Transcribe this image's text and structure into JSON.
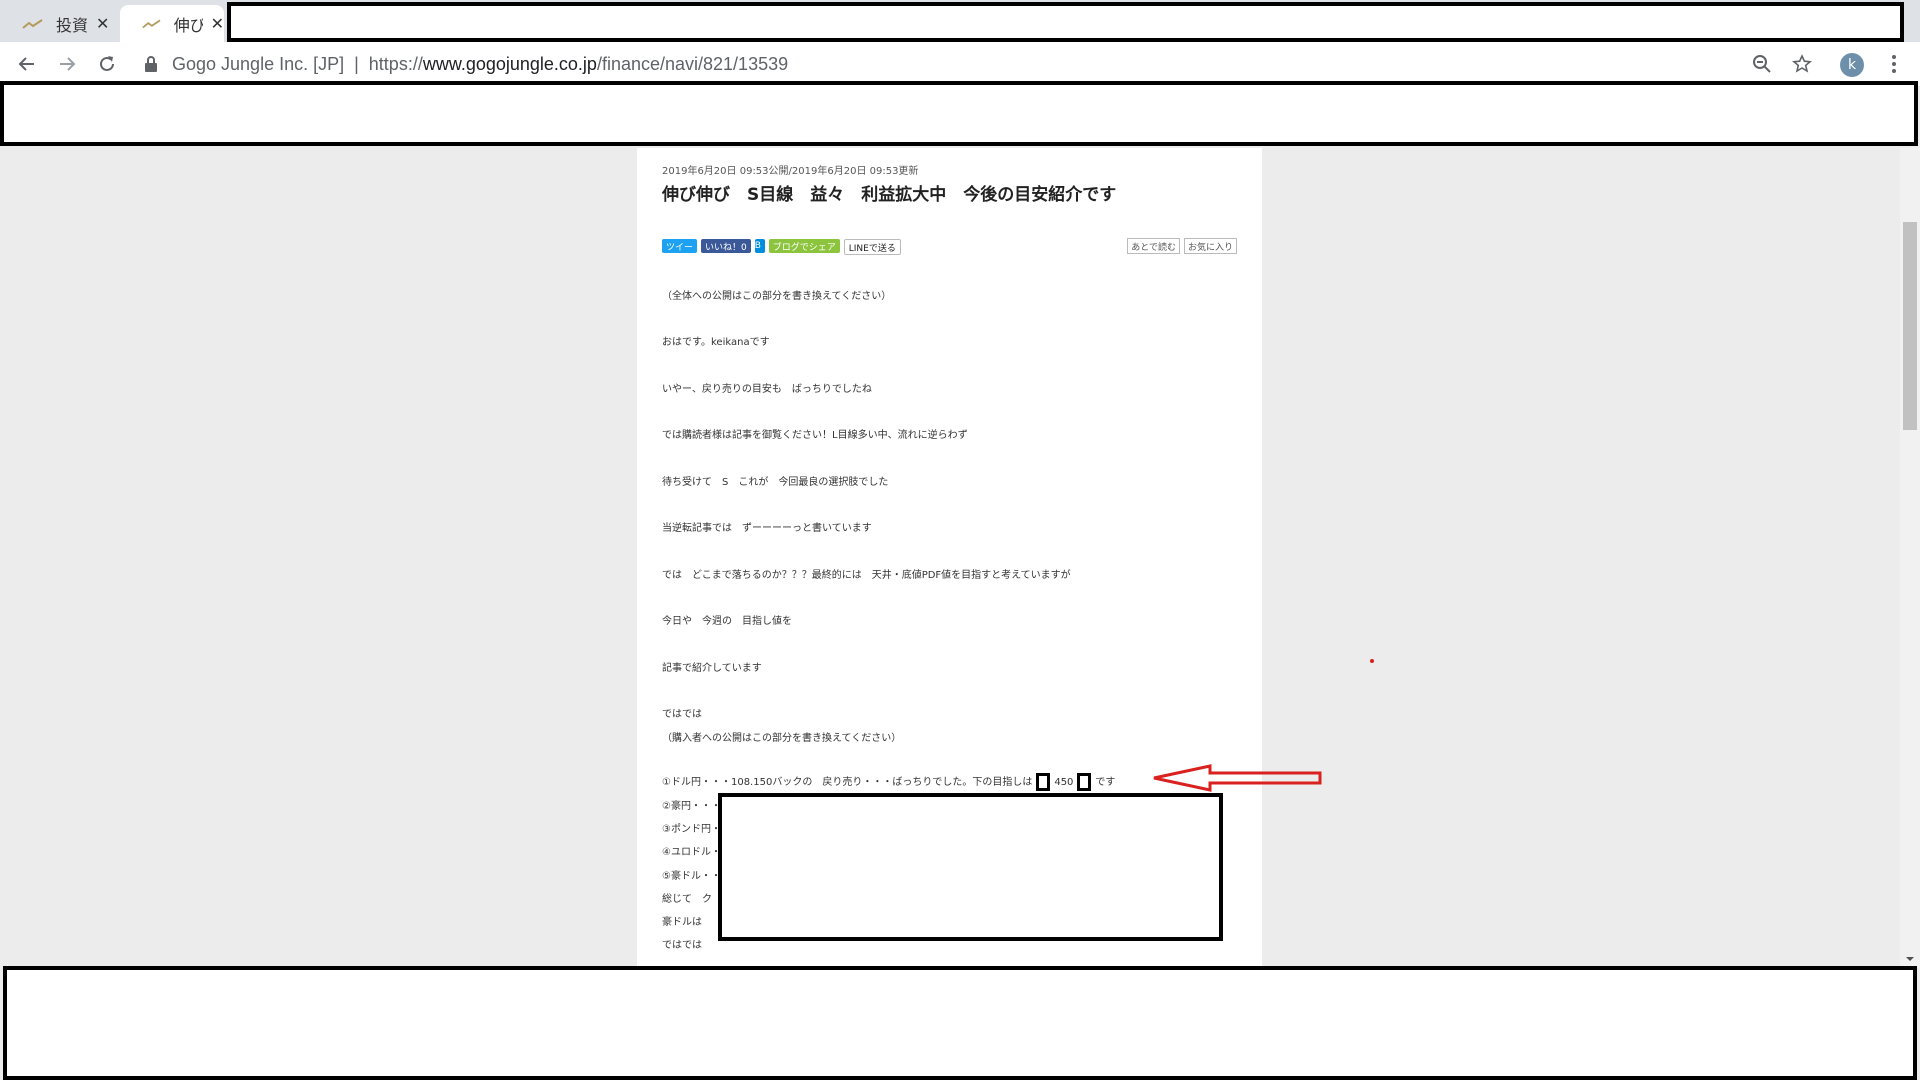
{
  "tabs": [
    {
      "title": "投資",
      "close": "✕"
    },
    {
      "title": "伸び",
      "close": "✕"
    }
  ],
  "toolbar": {
    "back_icon": "back-arrow-icon",
    "forward_icon": "forward-arrow-icon",
    "reload_icon": "reload-icon",
    "site_name": "Gogo Jungle Inc. [JP]",
    "separator": "|",
    "url_prefix": "https://",
    "url_host": "www.gogojungle.co.jp",
    "url_path": "/finance/navi/821/13539",
    "avatar_letter": "k"
  },
  "article": {
    "date": "2019年6月20日 09:53公開/2019年6月20日 09:53更新",
    "title": "伸び伸び　S目線　益々　利益拡大中　今後の目安紹介です",
    "share": {
      "tweet": "ツイー",
      "like": "いいね！0",
      "hatena": "B",
      "blog": "ブログでシェア",
      "line": "LINEで送る"
    },
    "read_later": "あとで読む",
    "favorite": "お気に入り",
    "paragraphs": [
      "（全体への公開はこの部分を書き換えてください）",
      "おはです。keikanaです",
      "いやー、戻り売りの目安も　ばっちりでしたね",
      "では購読者様は記事を御覧ください！L目線多い中、流れに逆らわず",
      "待ち受けて　S　これが　今回最良の選択肢でした",
      "当逆転記事では　ずーーーーっと書いています",
      "では　どこまで落ちるのか？？？最終的には　天井・底値PDF値を目指すと考えていますが",
      "今日や　今週の　目指し値を",
      "記事で紹介しています",
      "ではでは",
      "（購入者への公開はこの部分を書き換えてください）"
    ],
    "list_line1_pre": "①ドル円・・・108.150バックの　戻り売り・・・ばっちりでした。下の目指しは",
    "list_line1_num": "450",
    "list_line1_post": "です",
    "list_items": [
      "②豪円・・・",
      "③ポンド円・",
      "④ユロドル・",
      "⑤豪ドル・・",
      "総じて　ク",
      "豪ドルは　",
      "ではでは"
    ]
  },
  "colors": {
    "tabbar": "#dee1e6",
    "page_bg": "#ececec",
    "arrow": "#d9221f"
  }
}
